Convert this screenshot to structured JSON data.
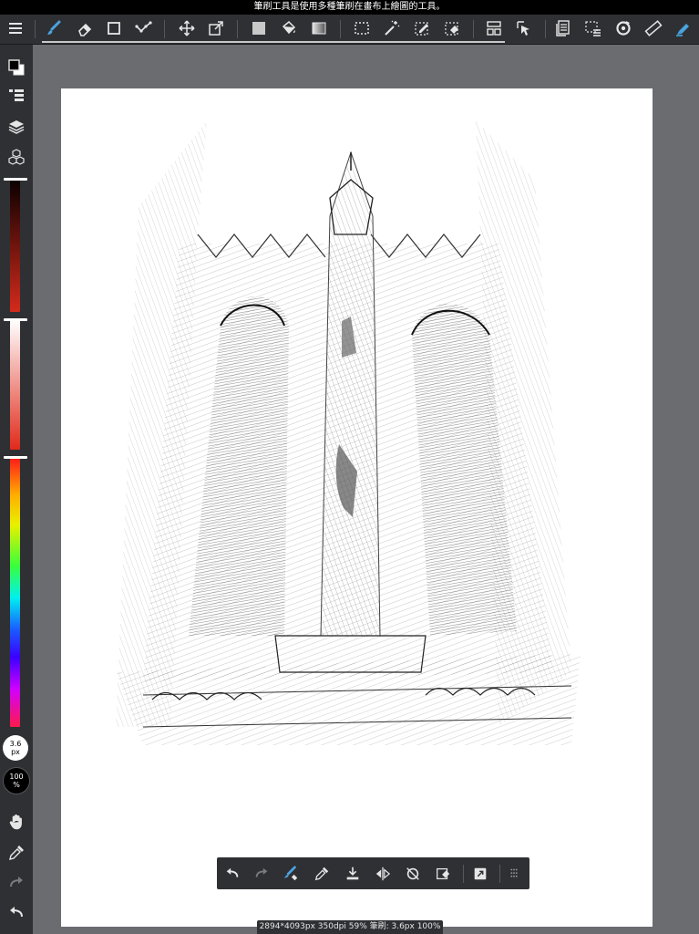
{
  "statusbar": {
    "hint": "筆刷工具是使用多種筆刷在畫布上繪圖的工具。"
  },
  "toolbar": {
    "items": [
      {
        "icon": "brush-icon",
        "active": true
      },
      {
        "icon": "eraser-icon"
      },
      {
        "icon": "shape-icon"
      },
      {
        "icon": "curve-icon"
      },
      {
        "icon": "move-icon"
      },
      {
        "icon": "transform-icon"
      },
      {
        "icon": "fill-color-icon"
      },
      {
        "icon": "bucket-icon"
      },
      {
        "icon": "gradient-icon"
      },
      {
        "icon": "select-rect-icon"
      },
      {
        "icon": "magic-wand-icon"
      },
      {
        "icon": "select-pen-icon"
      },
      {
        "icon": "select-eraser-icon"
      },
      {
        "icon": "layout-icon"
      },
      {
        "icon": "select-layer-icon"
      },
      {
        "icon": "copy-icon"
      },
      {
        "icon": "selection-icon"
      },
      {
        "icon": "rotate-icon"
      },
      {
        "icon": "ruler-icon"
      },
      {
        "icon": "pen-tool-icon"
      }
    ]
  },
  "sidebar": {
    "brush_size": {
      "value": "3.6",
      "unit": "px"
    },
    "opacity": {
      "value": "100",
      "unit": "%"
    },
    "color_primary": "#000000",
    "color_secondary": "#ffffff"
  },
  "info_bar": {
    "text": "2894*4093px 350dpi 59% 筆刷: 3.6px 100%"
  },
  "colors": {
    "accent": "#4aa3df",
    "panel": "#2f3034",
    "workspace": "#6b6c70"
  }
}
